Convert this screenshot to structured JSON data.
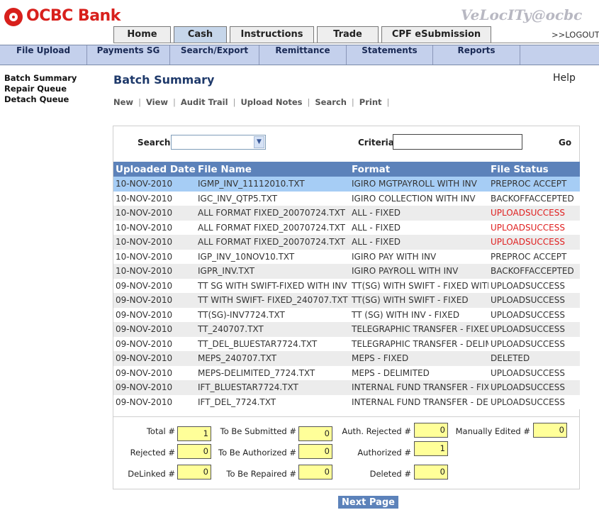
{
  "header": {
    "brand": "OCBC Bank",
    "velocity": "VeLocITy@ocbc",
    "logout": ">>LOGOUT",
    "logo_icon": "ocbc-logo-icon",
    "brand_color": "#d8201c"
  },
  "main_tabs": [
    "Home",
    "Cash",
    "Instructions",
    "Trade",
    "CPF eSubmission"
  ],
  "active_tab": "Cash",
  "sub_tabs": [
    "File Upload",
    "Payments SG",
    "Search/Export",
    "Remittance",
    "Statements",
    "Reports"
  ],
  "sidebar": [
    "Batch Summary",
    "Repair Queue",
    "Detach Queue"
  ],
  "page": {
    "title": "Batch Summary",
    "help": "Help",
    "actions": [
      "New",
      "View",
      "Audit Trail",
      "Upload Notes",
      "Search",
      "Print"
    ]
  },
  "search": {
    "label": "Search",
    "select_value": "",
    "criteria_label": "Criteria",
    "criteria_value": "",
    "go": "Go"
  },
  "table": {
    "columns": [
      "Uploaded Date",
      "File Name",
      "Format",
      "File Status"
    ],
    "rows": [
      [
        "10-NOV-2010",
        "IGMP_INV_11112010.TXT",
        "IGIRO MGTPAYROLL WITH INV",
        "PREPROC ACCEPT"
      ],
      [
        "10-NOV-2010",
        "IGC_INV_QTP5.TXT",
        "IGIRO COLLECTION WITH INV",
        "BACKOFFACCEPTED"
      ],
      [
        "10-NOV-2010",
        "ALL FORMAT FIXED_20070724.TXT",
        "ALL - FIXED",
        "UPLOADSUCCESS"
      ],
      [
        "10-NOV-2010",
        "ALL FORMAT FIXED_20070724.TXT",
        "ALL - FIXED",
        "UPLOADSUCCESS"
      ],
      [
        "10-NOV-2010",
        "ALL FORMAT FIXED_20070724.TXT",
        "ALL - FIXED",
        "UPLOADSUCCESS"
      ],
      [
        "10-NOV-2010",
        "IGP_INV_10NOV10.TXT",
        "IGIRO PAY WITH INV",
        "PREPROC ACCEPT"
      ],
      [
        "10-NOV-2010",
        "IGPR_INV.TXT",
        "IGIRO PAYROLL WITH INV",
        "BACKOFFACCEPTED"
      ],
      [
        "09-NOV-2010",
        "TT SG  WITH SWIFT-FIXED WITH INV",
        "TT(SG) WITH SWIFT - FIXED WITH",
        "UPLOADSUCCESS"
      ],
      [
        "09-NOV-2010",
        "TT WITH SWIFT- FIXED_240707.TXT",
        "TT(SG) WITH SWIFT - FIXED",
        "UPLOADSUCCESS"
      ],
      [
        "09-NOV-2010",
        "TT(SG)-INV7724.TXT",
        "TT (SG) WITH INV - FIXED",
        "UPLOADSUCCESS"
      ],
      [
        "09-NOV-2010",
        "TT_240707.TXT",
        "TELEGRAPHIC TRANSFER - FIXED",
        "UPLOADSUCCESS"
      ],
      [
        "09-NOV-2010",
        "TT_DEL_BLUESTAR7724.TXT",
        "TELEGRAPHIC TRANSFER - DELIM",
        "UPLOADSUCCESS"
      ],
      [
        "09-NOV-2010",
        "MEPS_240707.TXT",
        "MEPS - FIXED",
        "DELETED"
      ],
      [
        "09-NOV-2010",
        "MEPS-DELIMITED_7724.TXT",
        "MEPS - DELIMITED",
        "UPLOADSUCCESS"
      ],
      [
        "09-NOV-2010",
        "IFT_BLUESTAR7724.TXT",
        "INTERNAL FUND TRANSFER - FIXE",
        "UPLOADSUCCESS"
      ],
      [
        "09-NOV-2010",
        "IFT_DEL_7724.TXT",
        "INTERNAL FUND TRANSFER - DEL",
        "UPLOADSUCCESS"
      ]
    ],
    "selected_row": 0,
    "red_status_rows": [
      2,
      3,
      4
    ],
    "header_color": "#5c82ba",
    "selected_color": "#a6cdf5"
  },
  "counters": [
    {
      "label": "Total #",
      "value": "1"
    },
    {
      "label": "To Be Submitted #",
      "value": "0"
    },
    {
      "label": "Auth. Rejected #",
      "value": "0"
    },
    {
      "label": "Manually Edited #",
      "value": "0"
    },
    {
      "label": "Rejected #",
      "value": "0"
    },
    {
      "label": "To Be Authorized #",
      "value": "0"
    },
    {
      "label": "Authorized #",
      "value": "1"
    },
    {
      "label": "DeLinked #",
      "value": "0"
    },
    {
      "label": "To Be Repaired #",
      "value": "0"
    },
    {
      "label": "Deleted #",
      "value": "0"
    }
  ],
  "next_page": "Next Page"
}
